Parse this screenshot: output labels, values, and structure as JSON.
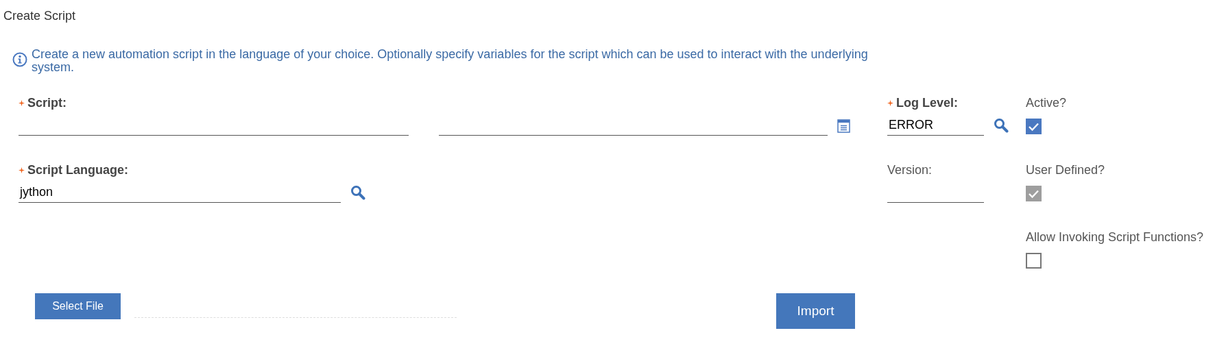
{
  "title": "Create Script",
  "info": "Create a new automation script in the language of your choice. Optionally specify variables for the script which can be used to interact with the underlying system.",
  "script": {
    "label": "Script:",
    "required": true
  },
  "log_level": {
    "label": "Log Level:",
    "required": true,
    "value": "ERROR"
  },
  "script_language": {
    "label": "Script Language:",
    "required": true,
    "value": "jython"
  },
  "version": {
    "label": "Version:",
    "required": false
  },
  "checkboxes": [
    {
      "label": "Active?",
      "checked": true,
      "disabled": false
    },
    {
      "label": "User Defined?",
      "checked": true,
      "disabled": true
    },
    {
      "label": "Allow Invoking Script Functions?",
      "checked": false,
      "disabled": false
    }
  ],
  "select_file_button": "Select File",
  "import_button": "Import"
}
